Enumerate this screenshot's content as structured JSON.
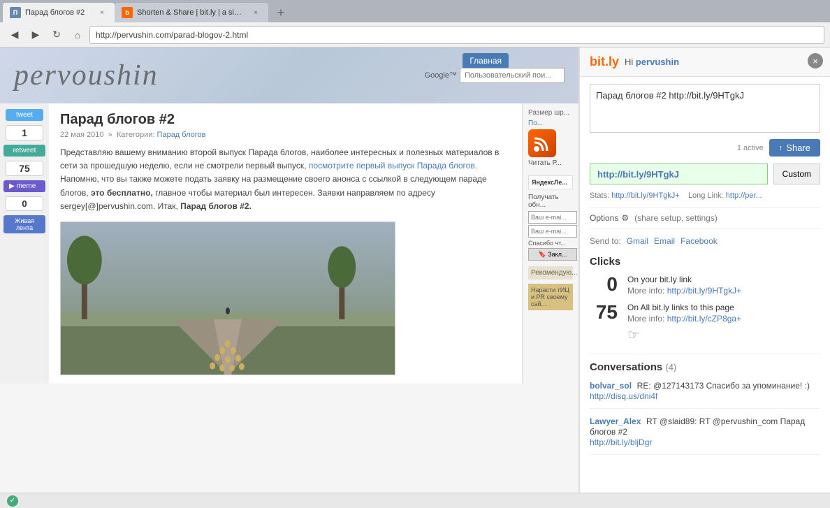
{
  "browser": {
    "tabs": [
      {
        "id": "tab1",
        "title": "Парад блогов #2",
        "active": true,
        "favicon": "P"
      },
      {
        "id": "tab2",
        "title": "Shorten & Share | bit.ly | a simple U...",
        "active": false,
        "favicon": "B"
      }
    ],
    "address": "http://pervushin.com/parad-blogov-2.html"
  },
  "blog": {
    "logo": "pervoushin",
    "nav_button": "Главная",
    "search_placeholder": "Пользовательский пои...",
    "sidebar_size_label": "Размер шр...",
    "post": {
      "title": "Парад блогов #2",
      "meta": "22 мая 2010",
      "category_label": "Категории:",
      "category": "Парад блогов",
      "text1": "Представляю вашему вниманию второй выпуск Парада блогов, наиболее интересных и полезных материалов в сети за прошедшую неделю, если не смотрели первый выпуск,",
      "text_link": "посмотрите первый выпуск Парада блогов.",
      "text2": "Напомню, что вы также можете подать заявку на размещение своего анонса с ссылкой в следующем параде блогов,",
      "text_bold": "это бесплатно,",
      "text3": "главное чтобы материал был интересен. Заявки направляем по адресу sergey[@]pervushin.com. Итак,",
      "text_bold2": "Парад блогов #2."
    },
    "social": {
      "tweet_label": "tweet",
      "tweet_count": "1",
      "retweet_label": "retweet",
      "retweet_count": "75",
      "meme_label": "▶ meme",
      "counter_value": "0",
      "zhivaya_label": "Живая лента"
    },
    "right_sidebar": {
      "po_label": "По...",
      "chitat_label": "Читать Р...",
      "poluchat_label": "Получать обн...",
      "email_placeholder": "Ваш e-mai...",
      "email_placeholder2": "Ваш e-mai...",
      "spasibo_label": "Спасибо чт...",
      "zakl_label": "🔖 Закл...",
      "recom_label": "Рекомендую...",
      "narastit_label": "Нарасти тИЦ и PR своему сай..."
    }
  },
  "bitly": {
    "logo": "bit.ly",
    "hi_label": "Hi",
    "username": "pervushin",
    "close_icon": "×",
    "share_text": "Парад блогов #2 http://bit.ly/9HTgkJ",
    "active_count": "1 active",
    "share_button": "Share",
    "share_icon": "↑",
    "bitly_link": "http://bit.ly/9HTgkJ",
    "custom_button": "Custom",
    "stats_label": "Stats:",
    "stats_link": "http://bit.ly/9HTgkJ+",
    "long_link_label": "Long Link:",
    "long_link": "http://per...",
    "options_label": "Options",
    "share_setup_label": "(share setup, settings)",
    "send_to_label": "Send to:",
    "send_gmail": "Gmail",
    "send_email": "Email",
    "send_facebook": "Facebook",
    "clicks_title": "Clicks",
    "click1_number": "0",
    "click1_desc": "On your bit.ly link",
    "click1_more": "More info:",
    "click1_link": "http://bit.ly/9HTgkJ+",
    "click2_number": "75",
    "click2_desc": "On All bit.ly links to this page",
    "click2_more": "More info:",
    "click2_link": "http://bit.ly/cZP8ga+",
    "conversations_title": "Conversations",
    "conversations_count": "(4)",
    "conv1_user": "bolvar_sol",
    "conv1_text": "RE: @127143173 Спасибо за упоминание! :)",
    "conv1_link": "http://disq.us/dni4f",
    "conv2_user": "Lawyer_Alex",
    "conv2_text": "RT @slaid89: RT @pervushin_com Парад блогов #2",
    "conv2_link": "http://bit.ly/bljDgr"
  },
  "statusbar": {
    "text": ""
  }
}
